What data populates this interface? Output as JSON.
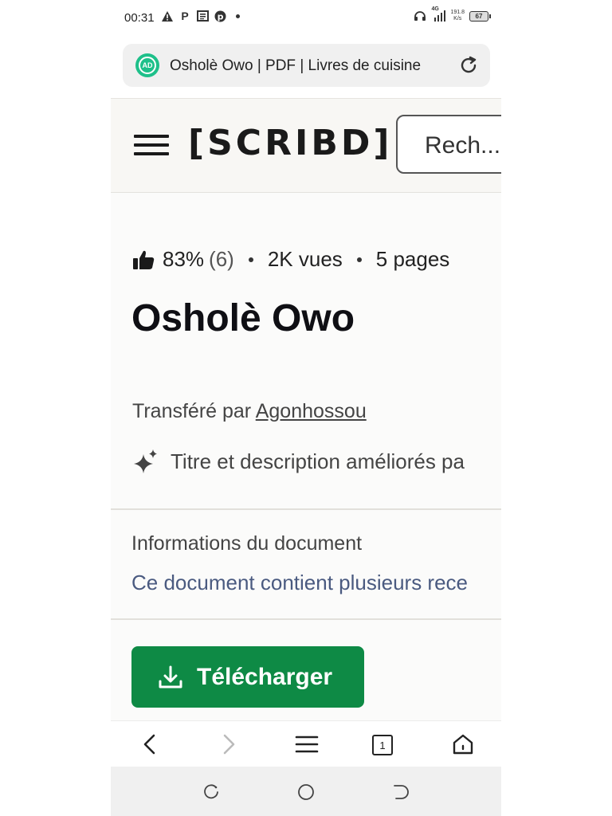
{
  "status_bar": {
    "time": "00:31",
    "network": "4G",
    "speed": "191.8",
    "speed_unit": "K/s",
    "battery": "67"
  },
  "url_bar": {
    "badge": "AD",
    "title": "Osholè Owo | PDF | Livres de cuisine"
  },
  "site_header": {
    "logo": "[SCRIBD]",
    "search_placeholder": "Rech..."
  },
  "document": {
    "rating": "83%",
    "rating_count": "(6)",
    "views": "2K vues",
    "pages": "5 pages",
    "title": "Osholè Owo",
    "uploaded_by_prefix": "Transféré par",
    "uploader": "Agonhossou",
    "ai_note": "Titre et description améliorés pa",
    "info_heading": "Informations du document",
    "info_description": "Ce document contient plusieurs rece",
    "download_label": "Télécharger"
  },
  "bottom_bar": {
    "tab_count": "1"
  },
  "colors": {
    "download_button": "#0e8a45",
    "header_bg": "#f8f7f4",
    "info_link": "#4a5a80",
    "badge": "#1ec08a"
  }
}
